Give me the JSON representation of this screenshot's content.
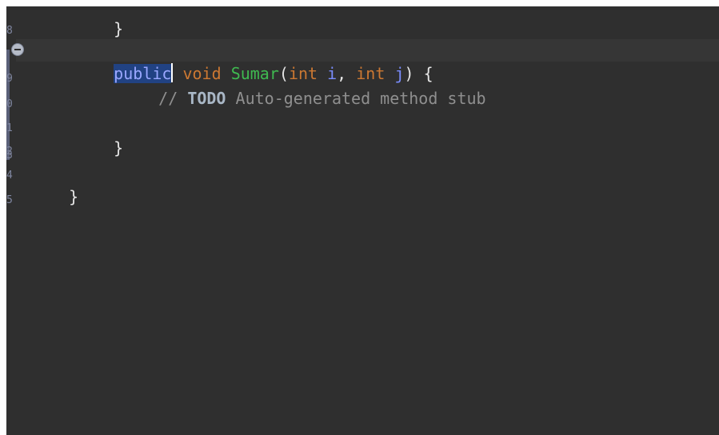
{
  "editor": {
    "gutter": {
      "line_numbers": [
        "8",
        "9",
        "0",
        "1",
        "2",
        "3",
        "4",
        "5"
      ]
    },
    "lines": {
      "prev_brace": "}",
      "method_keyword_public": "public",
      "method_keyword_void": "void",
      "method_name": "Sumar",
      "open_paren": "(",
      "param1_type": "int",
      "param1_name": "i",
      "comma": ",",
      "param2_type": "int",
      "param2_name": "j",
      "close_paren": ")",
      "open_brace": "{",
      "comment_prefix": "//",
      "todo_tag": "TODO",
      "comment_text": "Auto-generated method stub",
      "method_close_brace": "}",
      "class_close_brace": "}"
    }
  },
  "colors": {
    "background": "#2f2f2f",
    "keyword": "#cc7832",
    "method_name": "#3fb950",
    "parameter": "#7a8dff",
    "comment": "#8f8f8f",
    "selection": "#214283"
  }
}
